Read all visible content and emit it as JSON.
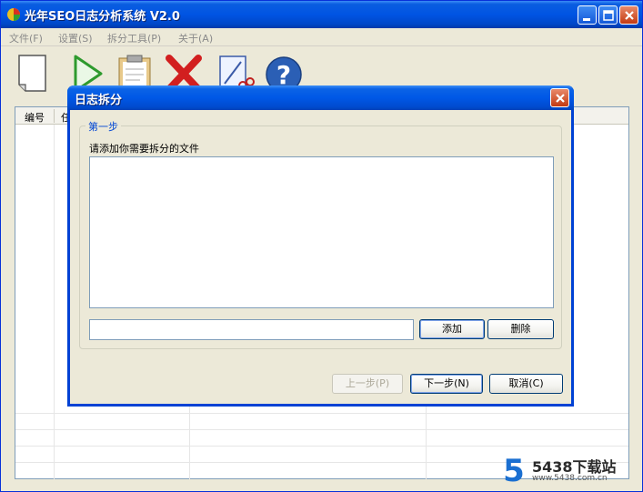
{
  "window": {
    "title": "光年SEO日志分析系统 V2.0",
    "minimize_icon": "minimize-icon",
    "maximize_icon": "maximize-icon",
    "close_icon": "close-icon"
  },
  "menu": {
    "items": [
      {
        "label": "文件(F)"
      },
      {
        "label": "设置(S)"
      },
      {
        "label": "拆分工具(P)"
      },
      {
        "label": "关于(A)"
      }
    ]
  },
  "toolbar": {
    "icons": [
      "new-document-icon",
      "play-icon",
      "clipboard-report-icon",
      "delete-x-icon",
      "split-tool-icon",
      "help-icon"
    ]
  },
  "listview": {
    "columns": [
      "编号",
      "任"
    ]
  },
  "dialog": {
    "title": "日志拆分",
    "group_label": "第一步",
    "prompt": "请添加你需要拆分的文件",
    "path_value": "",
    "add_label": "添加",
    "delete_label": "删除",
    "prev_label": "上一步(P)",
    "next_label": "下一步(N)",
    "cancel_label": "取消(C)"
  },
  "watermark": {
    "number": "5",
    "name": "5438下载站",
    "url": "www.5438.com.cn"
  },
  "colors": {
    "titlebar_blue": "#0054e3",
    "accent_text": "#0046d5",
    "close_red": "#c33a12",
    "watermark_blue": "#1a6fd1"
  }
}
